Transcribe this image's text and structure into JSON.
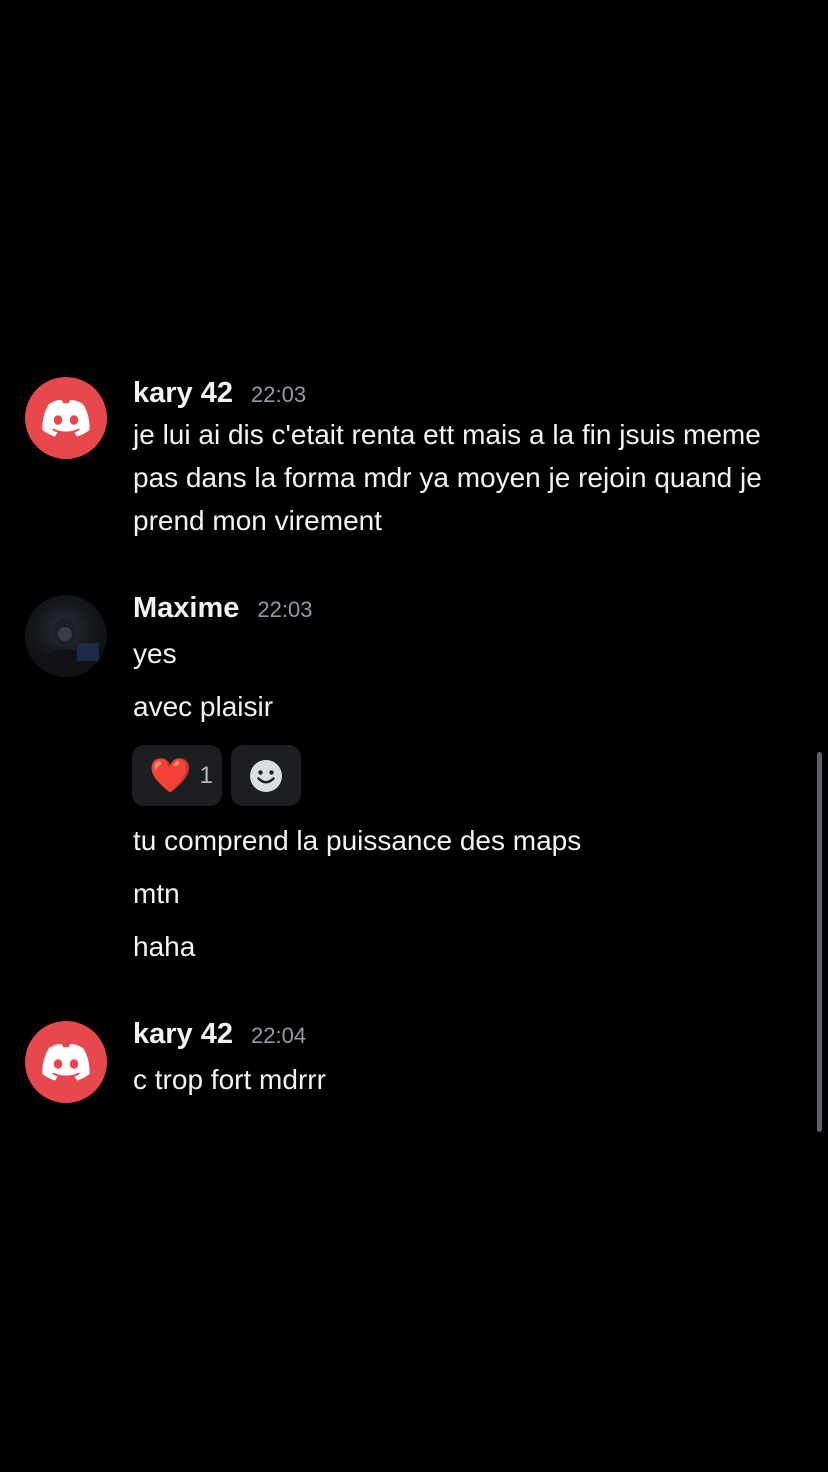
{
  "messages": [
    {
      "username": "kary 42",
      "timestamp": "22:03",
      "avatar_icon": "discord-logo-icon",
      "text": "je lui ai dis c'etait renta ett mais a la fin jsuis meme pas dans la forma mdr ya moyen je rejoin quand je prend mon virement"
    },
    {
      "username": "Maxime",
      "timestamp": "22:03",
      "avatar_icon": "user-photo",
      "lines": [
        "yes",
        "avec plaisir",
        "tu comprend la puissance des maps",
        "mtn",
        "haha"
      ],
      "reactions": [
        {
          "emoji": "❤️",
          "count": "1"
        },
        {
          "emoji": "add-reaction-icon",
          "count": ""
        }
      ]
    },
    {
      "username": "kary 42",
      "timestamp": "22:04",
      "avatar_icon": "discord-logo-icon",
      "text": "c trop fort mdrrr"
    }
  ],
  "colors": {
    "background": "#000000",
    "discord_red": "#e7484d",
    "text": "#f2f3f5",
    "timestamp": "#949ba4",
    "reaction_bg": "#1d1e22"
  }
}
